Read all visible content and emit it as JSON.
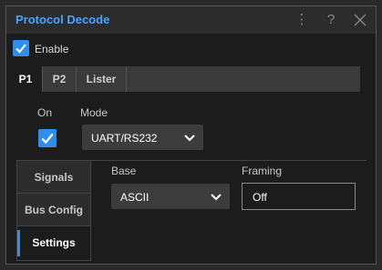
{
  "window": {
    "title": "Protocol Decode",
    "menu_icon": "vertical-dots-icon",
    "help_icon": "question-mark-icon",
    "close_icon": "close-x-icon"
  },
  "enable": {
    "label": "Enable",
    "checked": true
  },
  "tabs": [
    {
      "label": "P1",
      "active": true
    },
    {
      "label": "P2",
      "active": false
    },
    {
      "label": "Lister",
      "active": false
    }
  ],
  "on": {
    "label": "On",
    "checked": true
  },
  "mode": {
    "label": "Mode",
    "value": "UART/RS232"
  },
  "side_tabs": [
    {
      "label": "Signals",
      "active": false
    },
    {
      "label": "Bus Config",
      "active": false
    },
    {
      "label": "Settings",
      "active": true
    }
  ],
  "base": {
    "label": "Base",
    "value": "ASCII"
  },
  "framing": {
    "label": "Framing",
    "value": "Off"
  },
  "colors": {
    "accent": "#2f8df0",
    "title": "#4aa3ff",
    "background": "#1c1c1c"
  }
}
